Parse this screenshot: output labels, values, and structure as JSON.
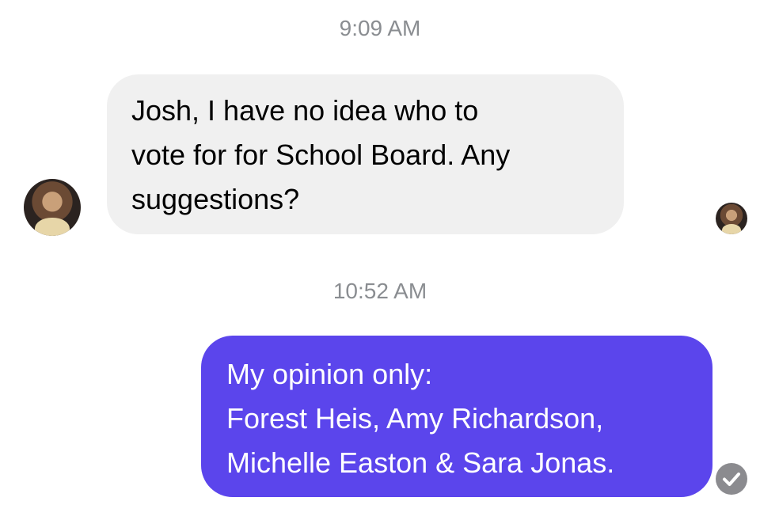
{
  "conversation": {
    "timestamps": [
      "9:09 AM",
      "10:52 AM"
    ],
    "messages": [
      {
        "direction": "incoming",
        "lines": [
          "Josh, I have no idea who to",
          "vote for for School Board. Any",
          "suggestions?"
        ]
      },
      {
        "direction": "outgoing",
        "lines": [
          "My opinion only:",
          "Forest Heis, Amy Richardson,",
          "Michelle Easton & Sara Jonas."
        ],
        "status_icon": "check-circle-icon"
      }
    ]
  },
  "colors": {
    "incoming_bubble": "#f0f0f0",
    "outgoing_bubble": "#5b45ec",
    "timestamp_text": "#8a8d91",
    "receipt": "#8b8b8f"
  }
}
